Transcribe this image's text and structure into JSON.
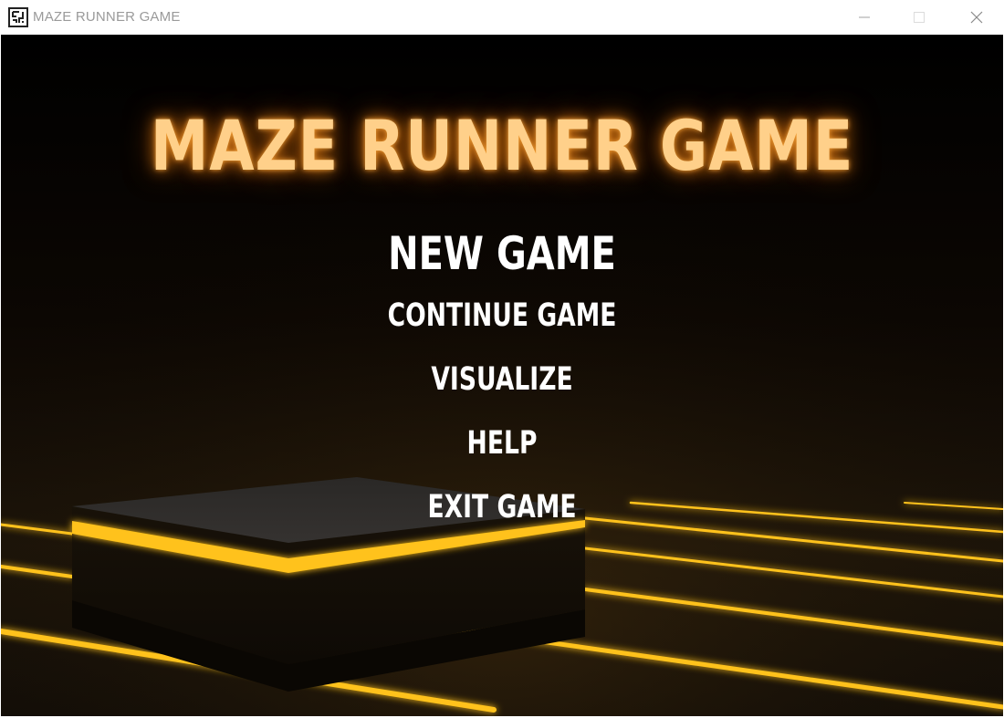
{
  "window": {
    "title": "MAZE RUNNER GAME",
    "controls": [
      "minimize",
      "maximize",
      "close"
    ]
  },
  "game": {
    "title": "MAZE RUNNER GAME",
    "menu": {
      "new_game": "NEW GAME",
      "continue_game": "CONTINUE GAME",
      "visualize": "VISUALIZE",
      "help": "HELP",
      "exit_game": "EXIT GAME"
    }
  },
  "theme": {
    "background": "#000000",
    "title_color": "#ffd08a",
    "title_glow": "#ff8c14",
    "menu_color": "#ffffff",
    "neon": "#ffc21a",
    "platform_top": "#2f2f2f",
    "platform_side": "#120d07"
  },
  "icons": {
    "app": "maze-icon",
    "minimize": "minimize-icon",
    "maximize": "maximize-icon",
    "close": "close-icon"
  }
}
